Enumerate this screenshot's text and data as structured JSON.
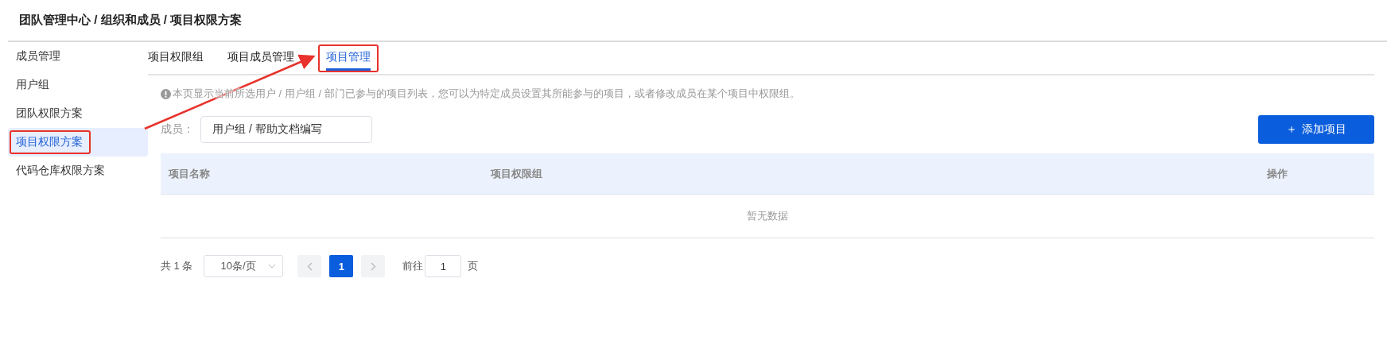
{
  "breadcrumb": "团队管理中心 / 组织和成员 / 项目权限方案",
  "sidebar": {
    "items": [
      {
        "label": "成员管理",
        "selected": false,
        "highlighted": false
      },
      {
        "label": "用户组",
        "selected": false,
        "highlighted": false
      },
      {
        "label": "团队权限方案",
        "selected": false,
        "highlighted": false
      },
      {
        "label": "项目权限方案",
        "selected": true,
        "highlighted": true
      },
      {
        "label": "代码仓库权限方案",
        "selected": false,
        "highlighted": false
      }
    ]
  },
  "tabs": [
    {
      "label": "项目权限组",
      "selected": false,
      "highlighted": false
    },
    {
      "label": "项目成员管理",
      "selected": false,
      "highlighted": false
    },
    {
      "label": "项目管理",
      "selected": true,
      "highlighted": true
    }
  ],
  "notice": "本页显示当前所选用户 / 用户组 / 部门已参与的项目列表，您可以为特定成员设置其所能参与的项目，或者修改成员在某个项目中权限组。",
  "member_filter": {
    "label": "成员：",
    "value": "用户组 / 帮助文档编写"
  },
  "add_button": {
    "icon": "＋",
    "label": "添加项目"
  },
  "table": {
    "columns": [
      "项目名称",
      "项目权限组",
      "操作"
    ],
    "empty_text": "暂无数据"
  },
  "pagination": {
    "total": "共 1 条",
    "page_size": "10条/页",
    "pages": [
      {
        "label": "1",
        "selected": true
      }
    ],
    "goto_label": "前往",
    "goto_value": "1",
    "page_suffix": "页"
  }
}
